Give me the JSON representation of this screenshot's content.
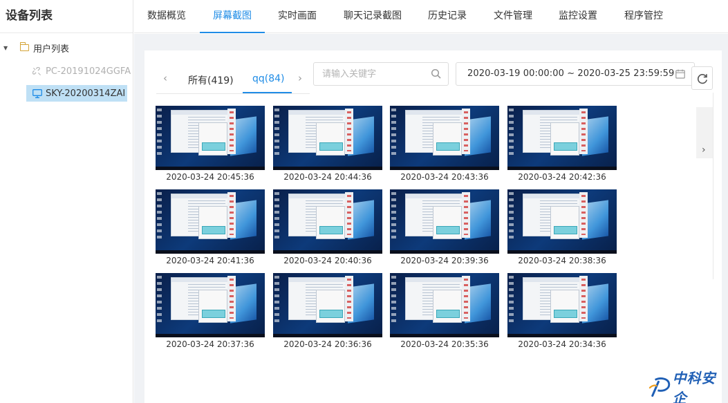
{
  "sidebar": {
    "title": "设备列表",
    "root_label": "用户列表",
    "devices": [
      {
        "label": "PC-20191024GGFA",
        "status": "offline"
      },
      {
        "label": "SKY-20200314ZAI",
        "status": "online"
      }
    ]
  },
  "nav": {
    "tabs": [
      "数据概览",
      "屏幕截图",
      "实时画面",
      "聊天记录截图",
      "历史记录",
      "文件管理",
      "监控设置",
      "程序管控"
    ],
    "active": "屏幕截图"
  },
  "filter_tabs": [
    {
      "label": "所有(419)",
      "active": false
    },
    {
      "label": "qq(84)",
      "active": true
    }
  ],
  "search": {
    "placeholder": "请输入关键字",
    "value": ""
  },
  "date_range": {
    "text": "2020-03-19 00:00:00 ~ 2020-03-25 23:59:59"
  },
  "screenshots": [
    {
      "time": "2020-03-24 20:45:36"
    },
    {
      "time": "2020-03-24 20:44:36"
    },
    {
      "time": "2020-03-24 20:43:36"
    },
    {
      "time": "2020-03-24 20:42:36"
    },
    {
      "time": "2020-03-24 20:41:36"
    },
    {
      "time": "2020-03-24 20:40:36"
    },
    {
      "time": "2020-03-24 20:39:36"
    },
    {
      "time": "2020-03-24 20:38:36"
    },
    {
      "time": "2020-03-24 20:37:36"
    },
    {
      "time": "2020-03-24 20:36:36"
    },
    {
      "time": "2020-03-24 20:35:36"
    },
    {
      "time": "2020-03-24 20:34:36"
    }
  ],
  "watermark": {
    "text": "中科安企"
  },
  "icons": {
    "tree_caret": "caret-down-icon",
    "root": "folder-icon",
    "offline_device": "link-broken-icon",
    "online_device": "monitor-icon",
    "search": "search-icon",
    "date": "calendar-icon",
    "refresh": "refresh-icon",
    "prev": "chevron-left-icon",
    "next": "chevron-right-icon"
  },
  "colors": {
    "accent": "#1f8ce6",
    "selected_bg": "#bfe0f5",
    "offline_text": "#b0b0b0",
    "page_bg": "#f0f2f5"
  }
}
